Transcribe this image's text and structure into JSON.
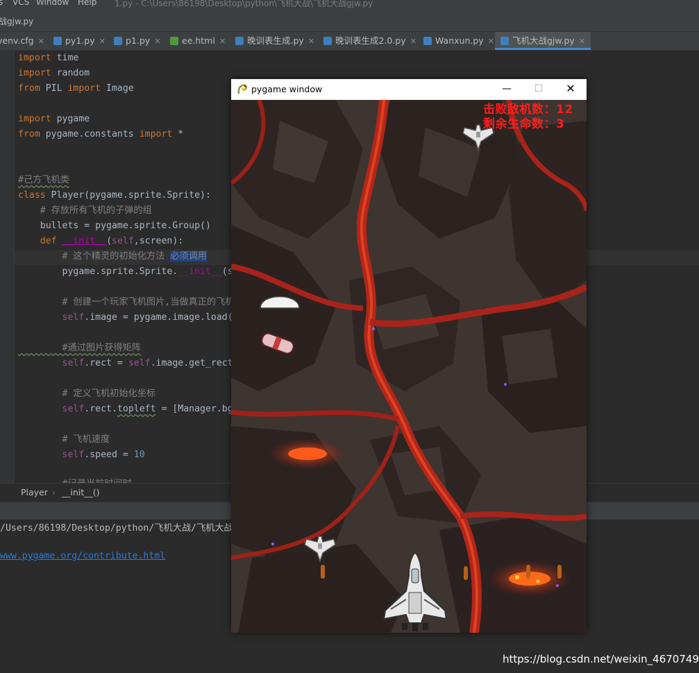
{
  "menubar": {
    "items": [
      "s",
      "VCS",
      "Window",
      "Help"
    ],
    "window_title": "1.py - C:\\Users\\86198\\Desktop\\python\\飞机大战\\飞机大战gjw.py"
  },
  "path": {
    "current_file": "大战gjw.py"
  },
  "tabs": [
    {
      "label": "venv.cfg",
      "icon": "config-file-icon",
      "color": "#8a8a8a",
      "active": false
    },
    {
      "label": "py1.py",
      "icon": "python-file-icon",
      "color": "#3f7fbf",
      "active": false
    },
    {
      "label": "p1.py",
      "icon": "python-file-icon",
      "color": "#3f7fbf",
      "active": false
    },
    {
      "label": "ee.html",
      "icon": "html-file-icon",
      "color": "#e8642b",
      "active": false
    },
    {
      "label": "晚训表生成.py",
      "icon": "python-file-icon",
      "color": "#3f7fbf",
      "active": false
    },
    {
      "label": "晚训表生成2.0.py",
      "icon": "python-file-icon",
      "color": "#3f7fbf",
      "active": false
    },
    {
      "label": "Wanxun.py",
      "icon": "python-file-icon",
      "color": "#3f7fbf",
      "active": false
    },
    {
      "label": "飞机大战gjw.py",
      "icon": "python-file-icon",
      "color": "#3f7fbf",
      "active": true
    }
  ],
  "code": {
    "l1a": "import",
    "l1b": " time",
    "l2a": "import",
    "l2b": " random",
    "l3a": "from",
    "l3b": " PIL ",
    "l3c": "import",
    "l3d": " Image",
    "l5a": "import",
    "l5b": " pygame",
    "l6a": "from",
    "l6b": " pygame.constants ",
    "l6c": "import",
    "l6d": " *",
    "l9": "#己方飞机类",
    "l10a": "class",
    "l10b": " Player(pygame.sprite.Sprite):",
    "l11": "    # 存放所有飞机的子弹的组",
    "l12": "    bullets = pygame.sprite.Group()",
    "l13a": "    def",
    "l13b": " ",
    "l13c": "__init__",
    "l13d": "(",
    "l13e": "self",
    "l13f": ",screen):",
    "l14a": "        # 这个精灵的初始化方法 ",
    "l14b": "必须调用",
    "l15a": "        pygame.sprite.Sprite.",
    "l15b": "__init__",
    "l15c": "(s",
    "l17": "        # 创建一个玩家飞机图片,当做真正的飞机",
    "l18a": "        ",
    "l18b": "self",
    "l18c": ".image = pygame.image.load(",
    "l20": "        #通过图片获得矩阵",
    "l21a": "        ",
    "l21b": "self",
    "l21c": ".rect = ",
    "l21d": "self",
    "l21e": ".image.get_rect",
    "l23": "        # 定义飞机初始化坐标",
    "l24a": "        ",
    "l24b": "self",
    "l24c": ".rect.",
    "l24d": "topleft",
    "l24e": " = [Manager.bg",
    "l26": "        # 飞机速度",
    "l27a": "        ",
    "l27b": "self",
    "l27c": ".speed = ",
    "l27d": "10",
    "l29": "        #记录当前时间时"
  },
  "breadcrumb": {
    "class_name": "Player",
    "method_name": "__init__()"
  },
  "console": {
    "path_line": "/Users/86198/Desktop/python/飞机大战/飞机大战",
    "link": "www.pygame.org/contribute.html"
  },
  "pygame_window": {
    "title": "pygame window",
    "minimize": "—",
    "maximize": "☐",
    "close": "✕"
  },
  "game": {
    "hud_kills": "击败敌机数：12",
    "hud_lives": "剩余生命数：3",
    "kills": 12,
    "lives": 3,
    "hud_color": "#ff1c1c"
  },
  "watermark": "https://blog.csdn.net/weixin_46707493"
}
